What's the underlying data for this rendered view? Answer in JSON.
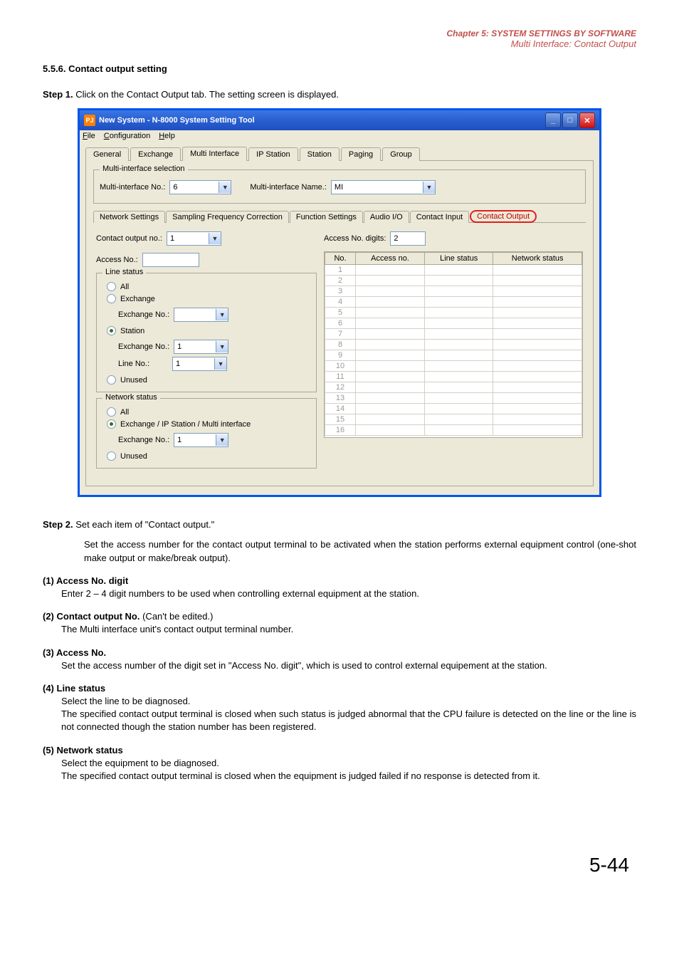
{
  "chapter": {
    "line1": "Chapter 5:  SYSTEM SETTINGS BY SOFTWARE",
    "line2": "Multi Interface: Contact Output"
  },
  "section_title": "5.5.6. Contact output setting",
  "step1": {
    "label": "Step 1.",
    "text": "Click on the Contact Output tab. The setting screen is displayed."
  },
  "window": {
    "title_icon": "PJ",
    "title": "New System - N-8000 System Setting Tool",
    "menus": {
      "file": "File",
      "configuration": "Configuration",
      "help": "Help"
    },
    "main_tabs": [
      "General",
      "Exchange",
      "Multi Interface",
      "IP Station",
      "Station",
      "Paging",
      "Group"
    ],
    "main_active_index": 2,
    "mi_selection": {
      "legend": "Multi-interface selection",
      "no_label": "Multi-interface No.:",
      "no_value": "6",
      "name_label": "Multi-interface Name.:",
      "name_value": "MI"
    },
    "sub_tabs": [
      "Network Settings",
      "Sampling Frequency Correction",
      "Function Settings",
      "Audio I/O",
      "Contact Input",
      "Contact Output"
    ],
    "sub_active_index": 5,
    "contact_output_no_label": "Contact output no.:",
    "contact_output_no_value": "1",
    "access_digits_label": "Access No. digits:",
    "access_digits_value": "2",
    "access_no_label": "Access No.:",
    "line_status": {
      "legend": "Line status",
      "all": "All",
      "exchange": "Exchange",
      "exchange_no_label": "Exchange No.:",
      "station": "Station",
      "station_exchange_no": "1",
      "line_no_label": "Line No.:",
      "line_no_value": "1",
      "unused": "Unused",
      "selected": "station"
    },
    "network_status": {
      "legend": "Network status",
      "all": "All",
      "exchange_ip": "Exchange / IP Station / Multi interface",
      "exchange_no_label": "Exchange No.:",
      "exchange_no_value": "1",
      "unused": "Unused",
      "selected": "exchange_ip"
    },
    "grid": {
      "headers": [
        "No.",
        "Access no.",
        "Line status",
        "Network status"
      ],
      "row_count": 16
    }
  },
  "step2": {
    "label": "Step 2.",
    "text": "Set each item of \"Contact output.\"",
    "desc": "Set the access number for the contact output terminal to be activated when the station performs external equipment control (one-shot make output or make/break output)."
  },
  "items": [
    {
      "num": "(1)",
      "head": "Access No. digit",
      "extra": "",
      "desc": "Enter 2 – 4 digit numbers to be used when controlling external equipment at the station."
    },
    {
      "num": "(2)",
      "head": "Contact output No.",
      "extra": " (Can't be edited.)",
      "desc": "The Multi interface unit's contact output terminal number."
    },
    {
      "num": "(3)",
      "head": "Access No.",
      "extra": "",
      "desc": "Set the access number of the digit set in \"Access No. digit\", which is used to control external equipement at the station."
    },
    {
      "num": "(4)",
      "head": "Line status",
      "extra": "",
      "desc": "Select the line to be diagnosed.\nThe specified contact output terminal is closed when such status is judged abnormal that the CPU failure is detected on the line or the line is not connected though the station number has been registered."
    },
    {
      "num": "(5)",
      "head": "Network status",
      "extra": "",
      "desc": "Select the equipment to be diagnosed.\nThe specified contact output terminal is closed when the equipment is judged failed if no response is detected from it."
    }
  ],
  "page_number": "5-44"
}
